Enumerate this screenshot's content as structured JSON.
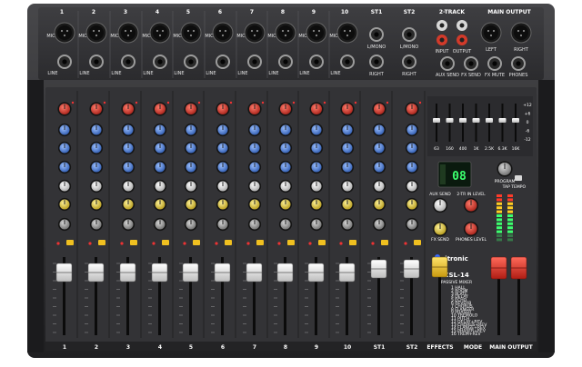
{
  "rear_panel": {
    "channel_numbers": [
      "1",
      "2",
      "3",
      "4",
      "5",
      "6",
      "7",
      "8",
      "9",
      "10"
    ],
    "stereo_labels": [
      "ST1",
      "ST2"
    ],
    "two_track_label": "2-TRACK",
    "main_output_label": "MAIN OUTPUT",
    "mic_label": "MIC",
    "line_label": "LINE",
    "l_mono_label": "L/MONO",
    "right_label": "RIGHT",
    "input_label": "INPUT",
    "output_label": "OUTPUT",
    "left_label": "LEFT",
    "aux_send_label": "AUX SEND",
    "fx_send_label": "FX SEND",
    "fx_mute_label": "FX MUTE",
    "phones_label": "PHONES"
  },
  "eq": {
    "bands": [
      "63",
      "160",
      "400",
      "1K",
      "2.5K",
      "6.3K",
      "16K"
    ],
    "scale": [
      "+12",
      "+6",
      "0",
      "-6",
      "-12"
    ]
  },
  "effects_section": {
    "display_value": "08",
    "program_label": "PROGRAM",
    "tap_label": "TAP TEMPO",
    "aux_send_label": "AUX SEND",
    "fx_send_label": "FX SEND",
    "phones_level_label": "2-TR IN LEVEL",
    "phones_level2_label": "PHONES LEVEL",
    "brand_name": "citronic",
    "model_name": "CSL-14",
    "model_subtitle": "PASSIVE MIXER",
    "effects_list": [
      "HALL",
      "ROOM",
      "PLATE",
      "DELAY",
      "ECHO",
      "REVERB",
      "CHORUS",
      "FLANGER",
      "PHASER",
      "TREMOLO",
      "PITCH",
      "DELAY+REV",
      "CHORUS+REV",
      "FLANGE+REV",
      "PHASER+REV",
      "TREM+REV"
    ]
  },
  "bottom_labels": {
    "channels": [
      "1",
      "2",
      "3",
      "4",
      "5",
      "6",
      "7",
      "8",
      "9",
      "10"
    ],
    "stereo": [
      "ST1",
      "ST2"
    ],
    "effects": "EFFECTS",
    "mode": "MODE",
    "main_output": "MAIN OUTPUT"
  },
  "fader_scale": [
    "10",
    "5",
    "0",
    "5",
    "10",
    "20",
    "30",
    "40",
    "∞"
  ],
  "colors": {
    "chassis": "#2a2a2c",
    "panel": "#3a3a3d",
    "gain_knob": "#d23a2a",
    "eq_knob": "#4a7ed8",
    "aux_knob": "#e9e9e9",
    "fx_knob": "#e9d24a",
    "main_fader": "#e0302a",
    "fx_fader": "#f0c020",
    "display": "#3cff6e"
  }
}
